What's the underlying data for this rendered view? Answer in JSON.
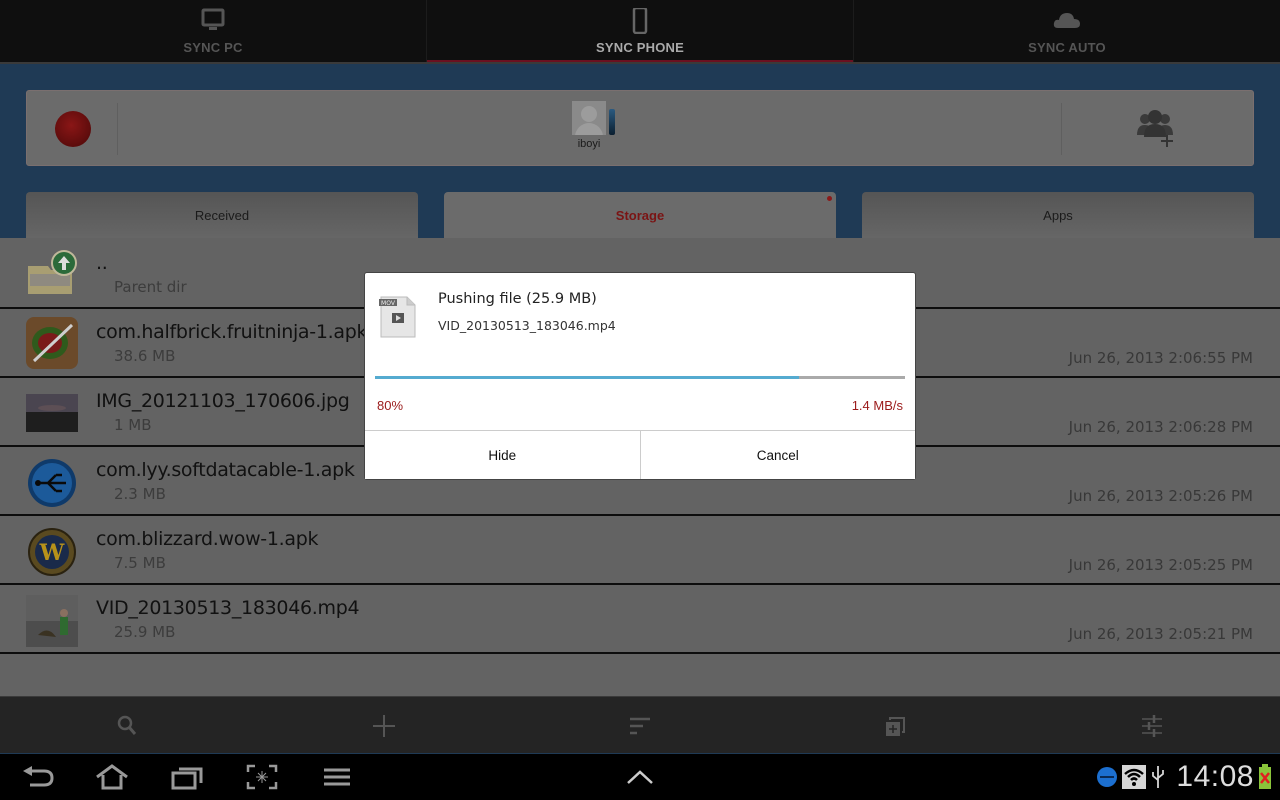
{
  "sync_tabs": [
    {
      "label": "SYNC PC",
      "icon": "monitor-icon",
      "active": false
    },
    {
      "label": "SYNC PHONE",
      "icon": "phone-icon",
      "active": true
    },
    {
      "label": "SYNC AUTO",
      "icon": "cloud-icon",
      "active": false
    }
  ],
  "device_panel": {
    "user_name": "iboyi",
    "record_icon": "record-icon",
    "add_user_icon": "add-user-icon"
  },
  "category_tabs": [
    {
      "label": "Received",
      "active": false
    },
    {
      "label": "Storage",
      "active": true,
      "has_notification_dot": true
    },
    {
      "label": "Apps",
      "active": false
    }
  ],
  "file_list": {
    "parent": {
      "name": "..",
      "subtitle": "Parent dir",
      "icon": "folder-up-icon"
    },
    "items": [
      {
        "name": "com.halfbrick.fruitninja-1.apk",
        "size": "38.6 MB",
        "date": "Jun 26, 2013 2:06:55 PM",
        "icon": "fruit-ninja-app-icon"
      },
      {
        "name": "IMG_20121103_170606.jpg",
        "size": "1 MB",
        "date": "Jun 26, 2013 2:06:28 PM",
        "icon": "image-thumbnail"
      },
      {
        "name": "com.lyy.softdatacable-1.apk",
        "size": "2.3 MB",
        "date": "Jun 26, 2013 2:05:26 PM",
        "icon": "usb-app-icon"
      },
      {
        "name": "com.blizzard.wow-1.apk",
        "size": "7.5 MB",
        "date": "Jun 26, 2013 2:05:25 PM",
        "icon": "wow-app-icon"
      },
      {
        "name": "VID_20130513_183046.mp4",
        "size": "25.9 MB",
        "date": "Jun 26, 2013 2:05:21 PM",
        "icon": "video-thumbnail"
      }
    ]
  },
  "dialog": {
    "title": "Pushing file (25.9 MB)",
    "filename": "VID_20130513_183046.mp4",
    "file_type_badge": "MOV",
    "progress_percent": 80,
    "progress_label": "80%",
    "speed": "1.4 MB/s",
    "hide_label": "Hide",
    "cancel_label": "Cancel",
    "progress_color": "#55abd0",
    "accent_color": "#9b1b1b"
  },
  "toolbar": {
    "items": [
      "search-icon",
      "add-icon",
      "sort-icon",
      "new-window-icon",
      "settings-sliders-icon"
    ]
  },
  "system_bar": {
    "nav_buttons": [
      "back-icon",
      "home-icon",
      "recent-apps-icon",
      "screenshot-icon",
      "menu-icon"
    ],
    "center_button": "chevron-up-icon",
    "time": "14:08",
    "status_icons": [
      "app-notification-icon",
      "wifi-icon",
      "usb-icon",
      "battery-icon"
    ]
  }
}
